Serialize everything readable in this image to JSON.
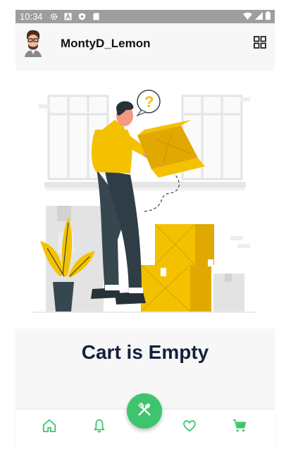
{
  "status_bar": {
    "time": "10:34",
    "left_icons": [
      "settings-icon",
      "a-badge-icon",
      "shield-icon",
      "sd-card-icon"
    ],
    "right_icons": [
      "wifi-icon",
      "signal-icon",
      "battery-icon"
    ]
  },
  "header": {
    "username": "MontyD_Lemon",
    "avatar_icon": "avatar",
    "menu_icon": "grid-icon"
  },
  "empty_state": {
    "title": "Cart is Empty",
    "illustration_icon": "man-with-box-illustration"
  },
  "bottom_nav": {
    "accent_color": "#3ec46d",
    "items": [
      {
        "icon": "home-icon"
      },
      {
        "icon": "bell-icon"
      },
      {
        "icon": "heart-icon"
      },
      {
        "icon": "cart-icon"
      }
    ],
    "fab_icon": "utensils-icon"
  }
}
